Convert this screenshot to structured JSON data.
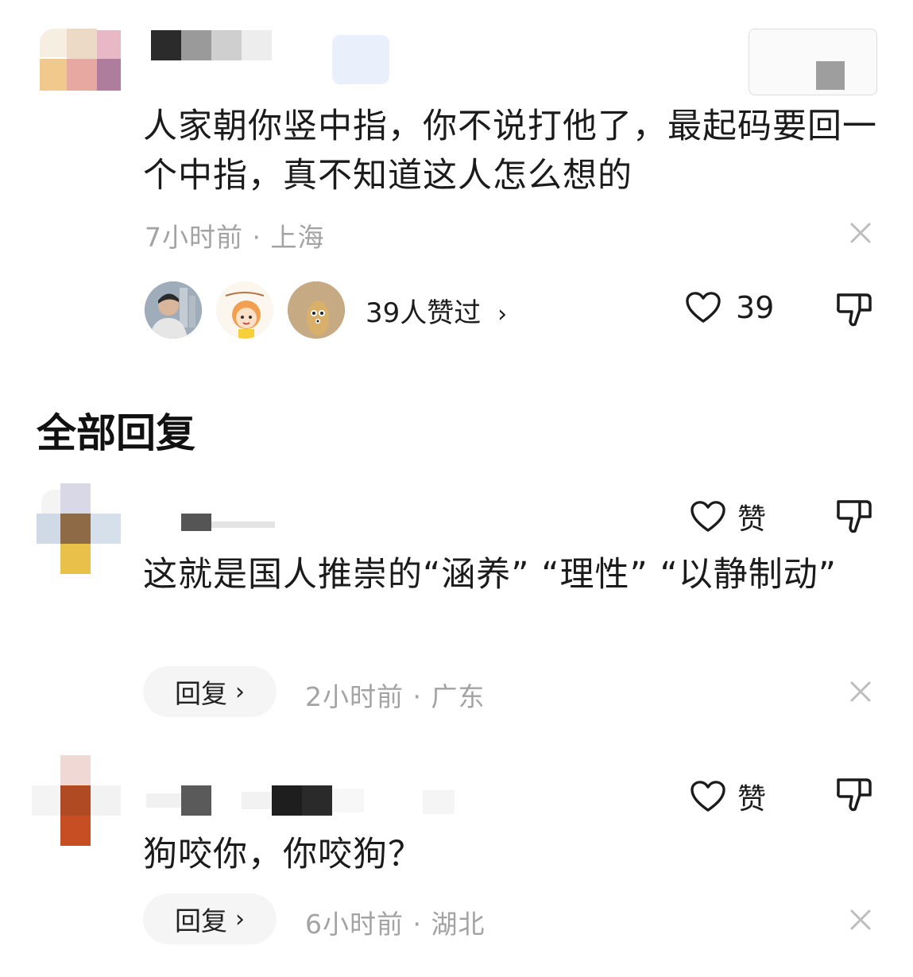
{
  "main_comment": {
    "text": "人家朝你竖中指，你不说打他了，最起码要回一个中指，真不知道这人怎么想的",
    "time": "7小时前",
    "location": "上海",
    "liked_by_label": "39人赞过",
    "like_count": "39"
  },
  "section_title": "全部回复",
  "replies": [
    {
      "text": "这就是国人推崇的“涵养” “理性” “以静制动”",
      "like_label": "赞",
      "reply_label": "回复",
      "time": "2小时前",
      "location": "广东"
    },
    {
      "text": "狗咬你，你咬狗？",
      "like_label": "赞",
      "reply_label": "回复",
      "time": "6小时前",
      "location": "湖北"
    }
  ],
  "icons": {
    "like": "heart-outline-icon",
    "dislike": "thumbs-down-icon",
    "close": "close-icon",
    "chevron": "chevron-right-icon"
  },
  "colors": {
    "text": "#1b1b1b",
    "meta": "#a3a3a3",
    "reply_pill": "#f5f5f5"
  }
}
